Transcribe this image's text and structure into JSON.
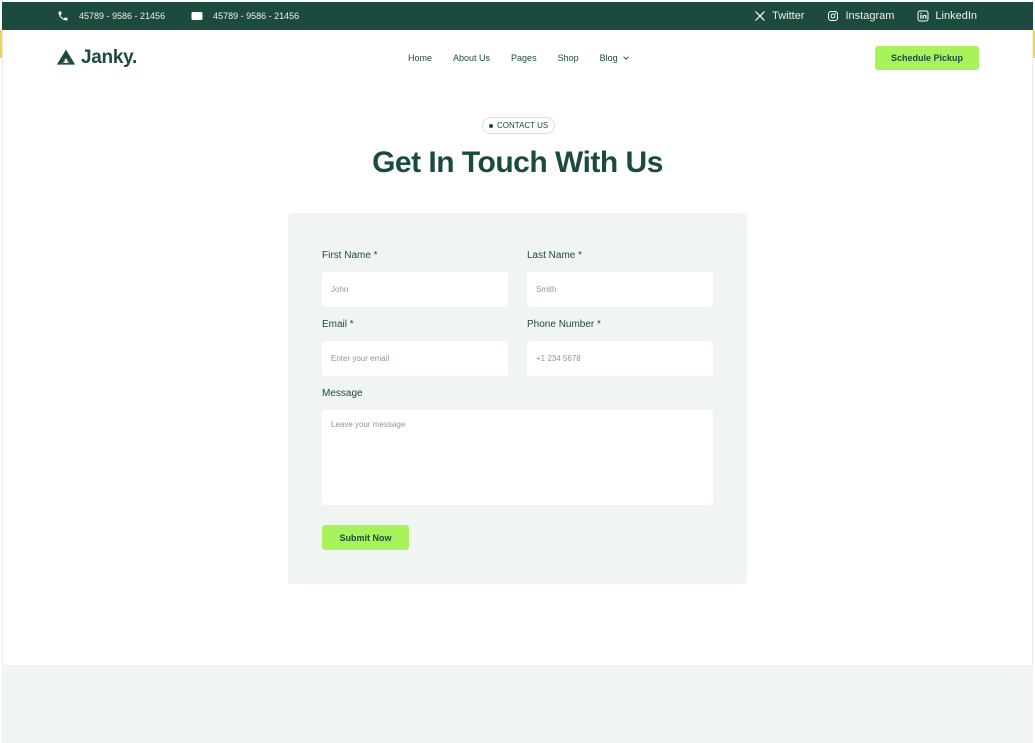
{
  "topbar": {
    "phone": "45789 - 9586 - 21456",
    "email": "45789 - 9586 - 21456",
    "socials": [
      {
        "label": "Twitter",
        "icon": "x-icon"
      },
      {
        "label": "Instagram",
        "icon": "instagram-icon"
      },
      {
        "label": "LinkedIn",
        "icon": "linkedin-icon"
      }
    ]
  },
  "header": {
    "logo_text": "Janky.",
    "nav": [
      "Home",
      "About Us",
      "Pages",
      "Shop",
      "Blog"
    ],
    "cta_label": "Schedule Pickup"
  },
  "hero": {
    "badge": "CONTACT US",
    "title": "Get In Touch With Us"
  },
  "form": {
    "first_name": {
      "label": "First Name *",
      "placeholder": "John"
    },
    "last_name": {
      "label": "Last Name *",
      "placeholder": "Smith"
    },
    "email": {
      "label": "Email *",
      "placeholder": "Enter your email"
    },
    "phone": {
      "label": "Phone Number *",
      "placeholder": "+1 234 5678"
    },
    "message": {
      "label": "Message",
      "placeholder": "Leave your message"
    },
    "submit_label": "Submit Now"
  },
  "colors": {
    "brand_dark": "#1d4a3e",
    "accent": "#a8f25b",
    "card_bg": "#f1f5f2"
  }
}
